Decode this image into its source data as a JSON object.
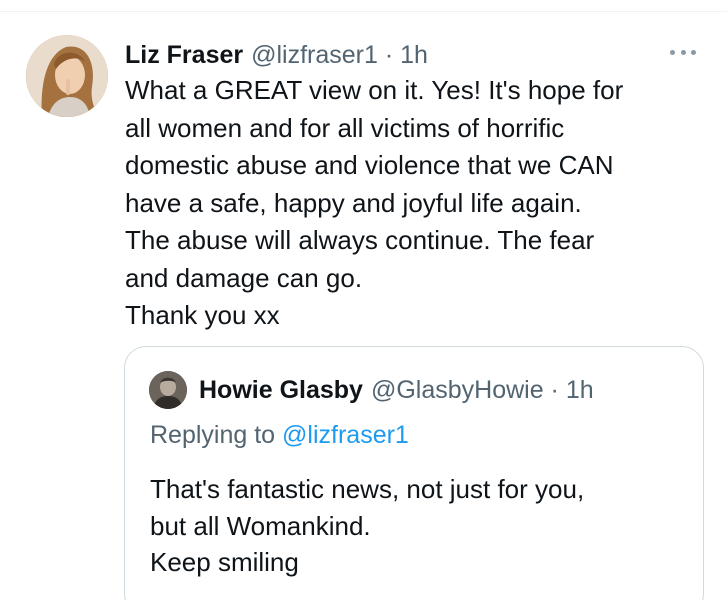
{
  "tweet": {
    "author_name": "Liz Fraser",
    "handle_time": "@lizfraser1 · 1h",
    "more_icon": "more-horizontal-icon",
    "text_lines": [
      "What a GREAT view on it. Yes! It's hope for",
      "all women and for all victims of horrific",
      "domestic abuse and violence that we CAN",
      "have a safe, happy and joyful life again.",
      "The abuse will always continue. The fear",
      "and damage can go.",
      "Thank you xx"
    ]
  },
  "quote": {
    "author_name": "Howie Glasby",
    "handle_time": "@GlasbyHowie · 1h",
    "replying_prefix": "Replying to ",
    "replying_mention": "@lizfraser1",
    "text_lines": [
      "That's fantastic news, not just for you,",
      "but all Womankind.",
      "Keep smiling"
    ]
  },
  "colors": {
    "text_primary": "#0f1419",
    "text_secondary": "#536471",
    "link": "#1d9bf0",
    "border": "#cfd9de"
  }
}
